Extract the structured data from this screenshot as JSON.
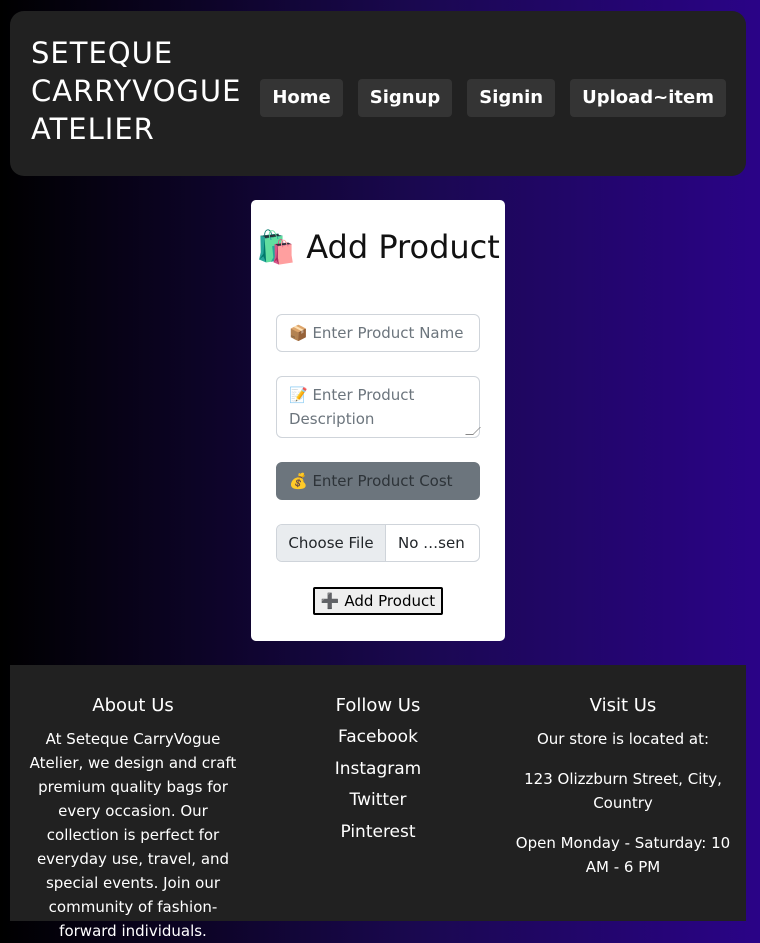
{
  "header": {
    "brand": "SETEQUE CARRYVOGUE ATELIER",
    "nav": [
      "Home",
      "Signup",
      "Signin",
      "Upload~item"
    ]
  },
  "form": {
    "title": "🛍️ Add Product",
    "name_placeholder": "📦 Enter Product Name",
    "description_placeholder": "📝 Enter Product Description",
    "cost_placeholder": "💰 Enter Product Cost",
    "file_button": "Choose File",
    "file_status": "No …sen",
    "submit_label": "➕ Add Product"
  },
  "footer": {
    "about": {
      "heading": "About Us",
      "text": "At Seteque CarryVogue Atelier, we design and craft premium quality bags for every occasion. Our collection is perfect for everyday use, travel, and special events. Join our community of fashion-forward individuals."
    },
    "follow": {
      "heading": "Follow Us",
      "links": [
        "Facebook",
        "Instagram",
        "Twitter",
        "Pinterest"
      ]
    },
    "visit": {
      "heading": "Visit Us",
      "line1": "Our store is located at:",
      "address": "123 Olizzburn Street, City, Country",
      "hours": "Open Monday - Saturday: 10 AM - 6 PM"
    }
  },
  "colors": {
    "header_bg": "#212121",
    "nav_button_bg": "#343434",
    "gradient_end": "#2a0387"
  }
}
